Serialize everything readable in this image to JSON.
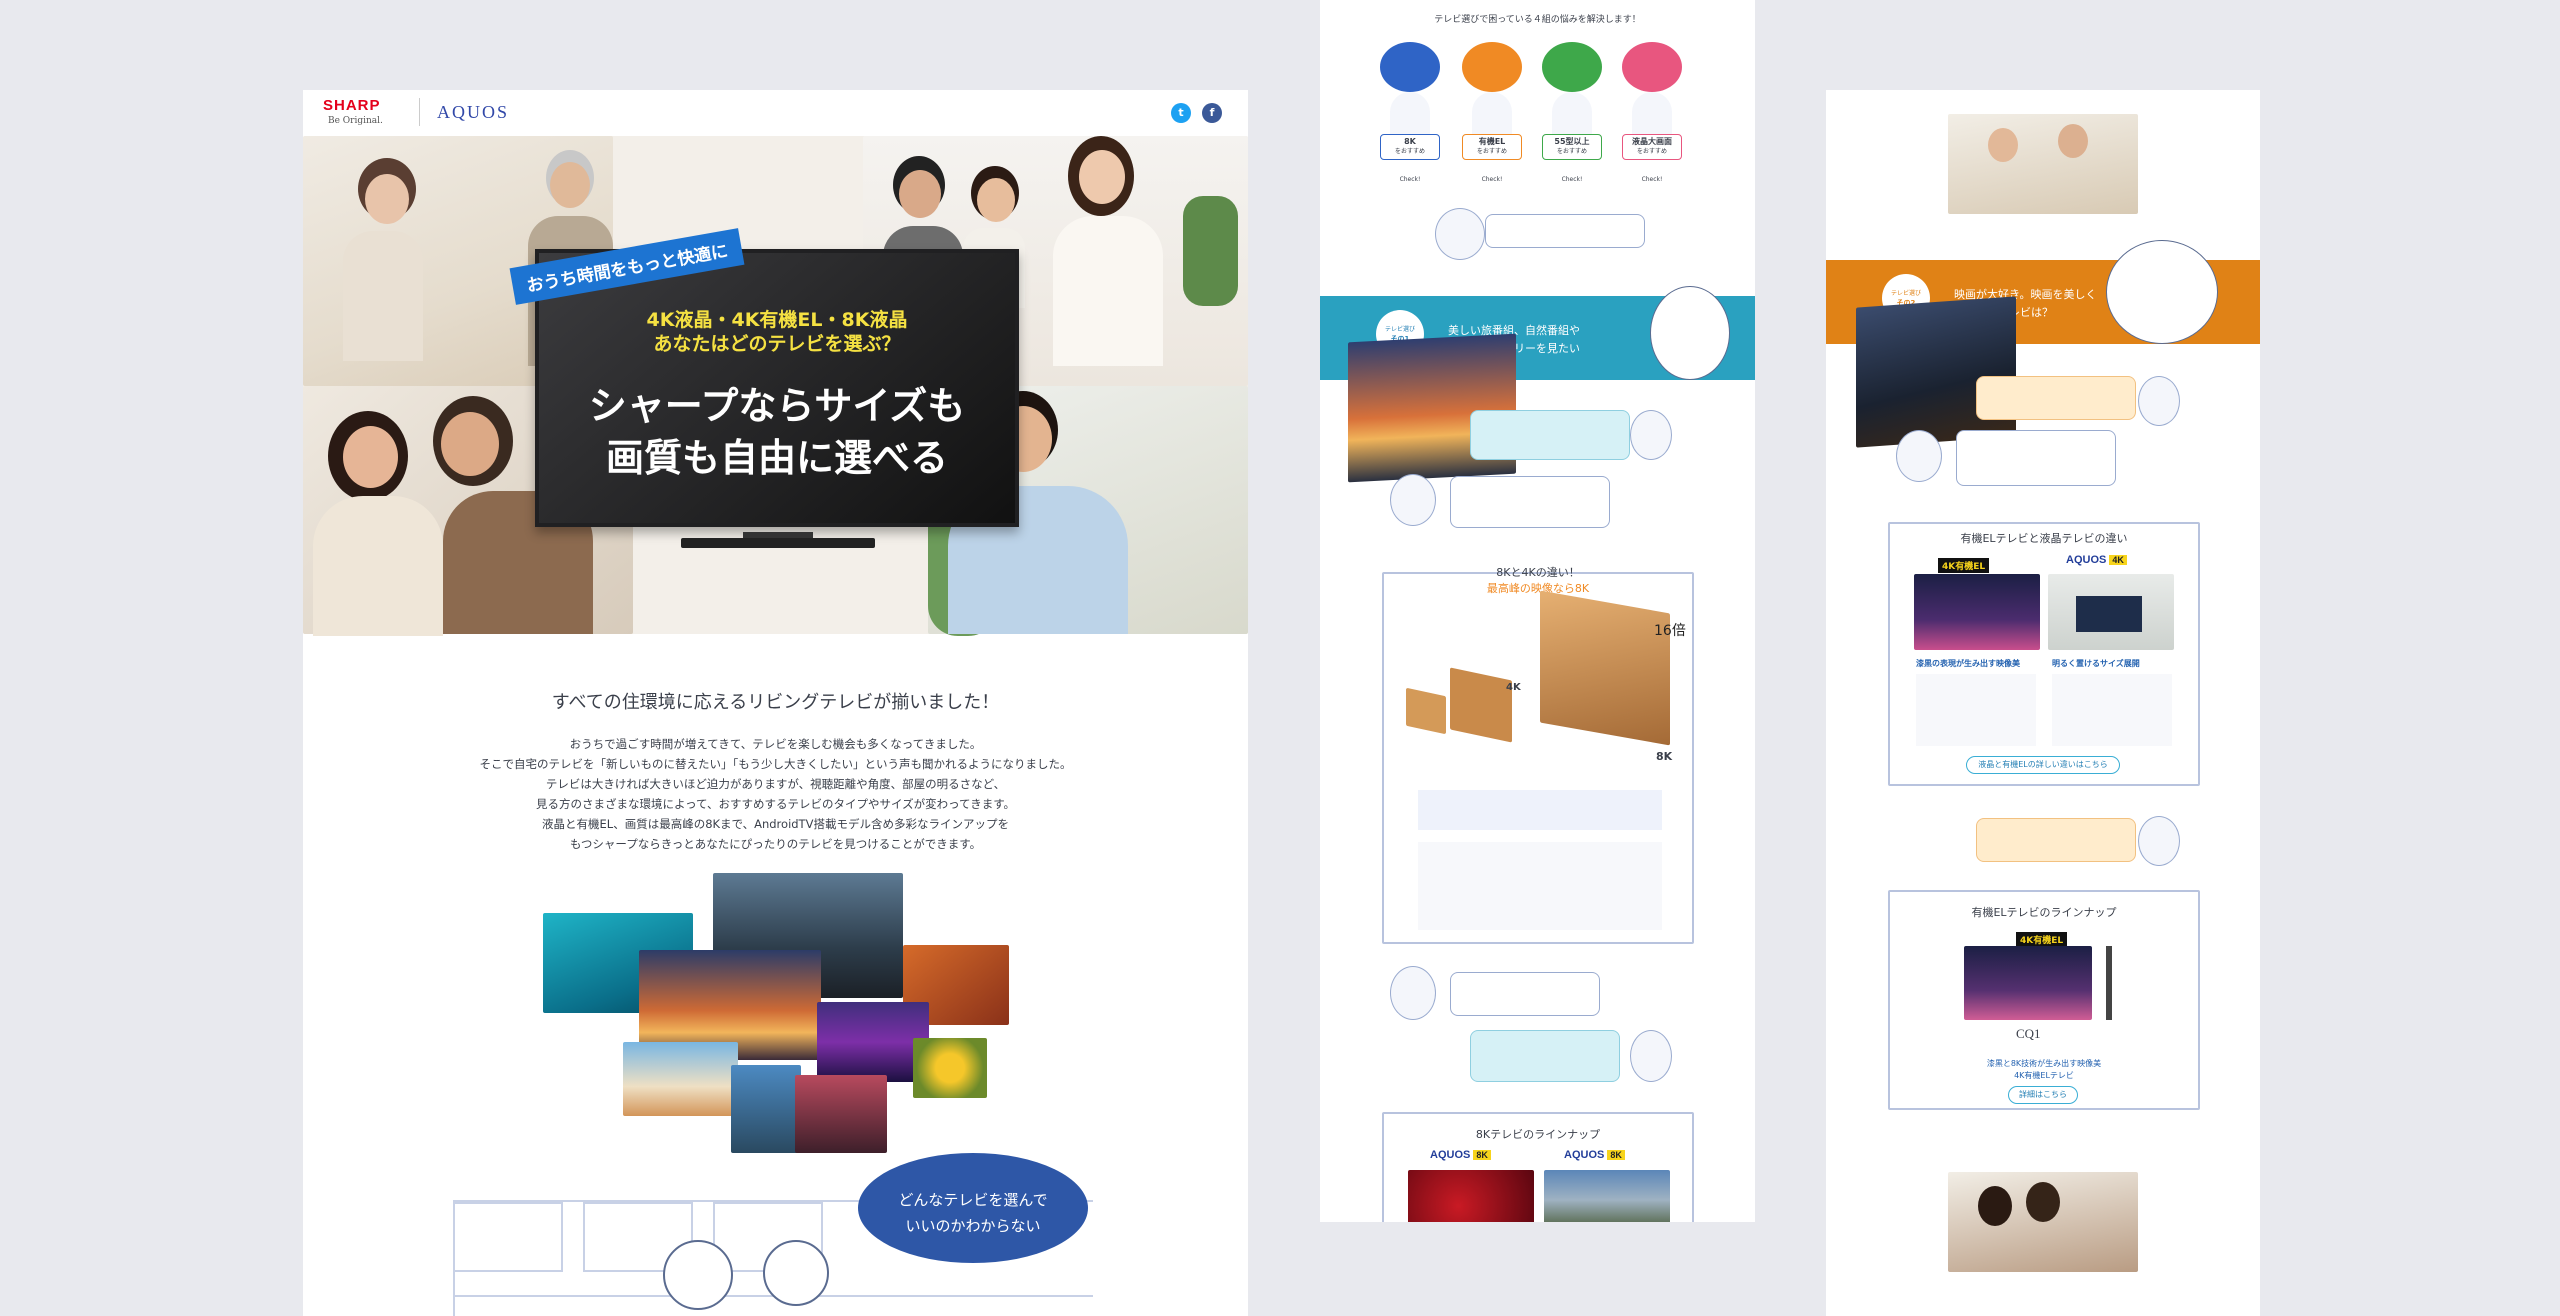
{
  "page1": {
    "header": {
      "brand": "SHARP",
      "tagline": "Be Original.",
      "product": "AQUOS",
      "twitter": "t",
      "facebook": "f"
    },
    "hero": {
      "badge": "おうち時間をもっと快適に",
      "subtitle_1": "4K液晶・4K有機EL・8K液晶",
      "subtitle_2": "あなたはどのテレビを選ぶ？",
      "title_1": "シャープならサイズも",
      "title_2": "画質も自由に選べる"
    },
    "intro": {
      "heading": "すべての住環境に応えるリビングテレビが揃いました！",
      "lines": [
        "おうちで過ごす時間が増えてきて、テレビを楽しむ機会も多くなってきました。",
        "そこで自宅のテレビを「新しいものに替えたい」「もう少し大きくしたい」という声も聞かれるようになりました。",
        "テレビは大きければ大きいほど迫力がありますが、視聴距離や角度、部屋の明るさなど、",
        "見る方のさまざまな環境によって、おすすめするテレビのタイプやサイズが変わってきます。",
        "液晶と有機EL、画質は最高峰の8Kまで、AndroidTV搭載モデル含め多彩なラインアップを",
        "もつシャープならきっとあなたにぴったりのテレビを見つけることができます。"
      ]
    },
    "speech": {
      "line_1": "どんなテレビを選んで",
      "line_2": "いいのかわからない"
    }
  },
  "page2": {
    "worries_title": "テレビ選びで困っている４組の悩みを解決します！",
    "worries": [
      {
        "rec": "8K",
        "sub": "をおすすめ",
        "check": "Check!",
        "color": "#2f64c6"
      },
      {
        "rec": "有機EL",
        "sub": "をおすすめ",
        "check": "Check!",
        "color": "#f08a24"
      },
      {
        "rec": "55型以上",
        "sub": "をおすすめ",
        "check": "Check!",
        "color": "#3ea84a"
      },
      {
        "rec": "液晶大画面",
        "sub": "をおすすめ",
        "check": "Check!",
        "color": "#e8567f"
      }
    ],
    "section1": {
      "label_1": "テレビ選び",
      "label_2": "その1",
      "title_1": "美しい旅番組、自然番組や",
      "title_2": "ドキュメンタリーを見たい"
    },
    "box8k": {
      "title_1": "8Kと4Kの違い！",
      "title_2": "最高峰の映像なら8K",
      "times": "16倍",
      "k4": "4K",
      "k8": "8K"
    },
    "lineup8k": {
      "title": "8Kテレビのラインナップ",
      "brand": "AQUOS",
      "badge": "8K"
    }
  },
  "page3": {
    "section2": {
      "label_1": "テレビ選び",
      "label_2": "その2",
      "title_1": "映画が大好き。映画を美しく",
      "title_2": "見られるテレビは？"
    },
    "compare": {
      "title": "有機ELテレビと液晶テレビの違い",
      "oled_badge": "4K有機EL",
      "lcd_brand": "AQUOS",
      "lcd_badge": "4K",
      "oled_head": "漆黒の表現が生み出す映像美",
      "lcd_head": "明るく置けるサイズ展開",
      "link": "液晶と有機ELの詳しい違いはこちら"
    },
    "lineup": {
      "title": "有機ELテレビのラインナップ",
      "badge": "4K有機EL",
      "model": "CQ1",
      "desc_1": "漆黒と8K技術が生み出す映像美",
      "desc_2": "4K有機ELテレビ",
      "link": "詳細はこちら"
    }
  }
}
